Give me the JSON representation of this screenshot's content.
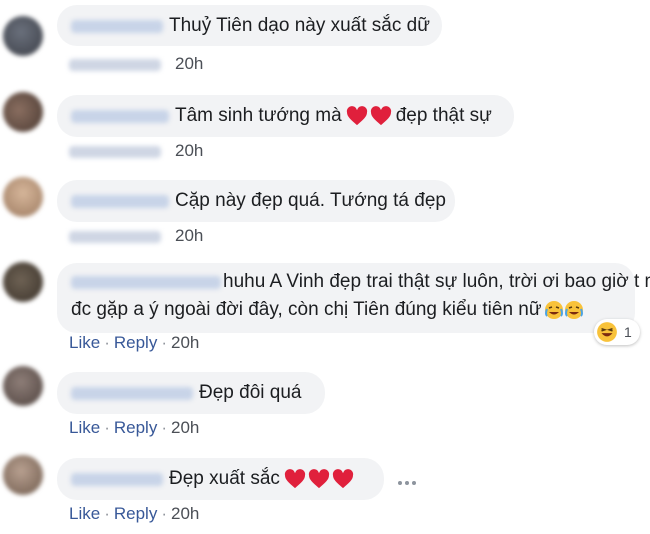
{
  "comments": [
    {
      "text": "Thuỷ Tiên dạo này xuất sắc dữ",
      "time": "20h",
      "avatar_color": "#4a4e58"
    },
    {
      "text_before": "Tâm sinh tướng mà",
      "text_after": "đẹp thật sự",
      "time": "20h",
      "avatar_color": "#5f4a42"
    },
    {
      "text": "Cặp này đẹp quá. Tướng tá đẹp",
      "time": "20h",
      "avatar_color": "#b58e72"
    },
    {
      "line1": "huhu A Vinh đẹp trai thật sự luôn, trời ơi bao giờ t ms",
      "line2": "đc gặp a ý ngoài đời đây, còn chị Tiên đúng kiểu tiên nữ",
      "time": "20h",
      "avatar_color": "#4a4238",
      "reaction_count": "1"
    },
    {
      "text": "Đẹp đôi quá",
      "time": "20h",
      "avatar_color": "#6b5a54"
    },
    {
      "text": "Đẹp xuất sắc",
      "time": "20h",
      "avatar_color": "#8f7a6a"
    }
  ],
  "actions": {
    "like": "Like",
    "reply": "Reply",
    "separator": "·"
  },
  "colors": {
    "bubble": "#f2f3f5",
    "link": "#385898",
    "heart": "#e0203c"
  },
  "icons": [
    "heart-icon",
    "crying-laughing-emoji-icon",
    "laughing-reaction-icon",
    "more-options-icon"
  ]
}
